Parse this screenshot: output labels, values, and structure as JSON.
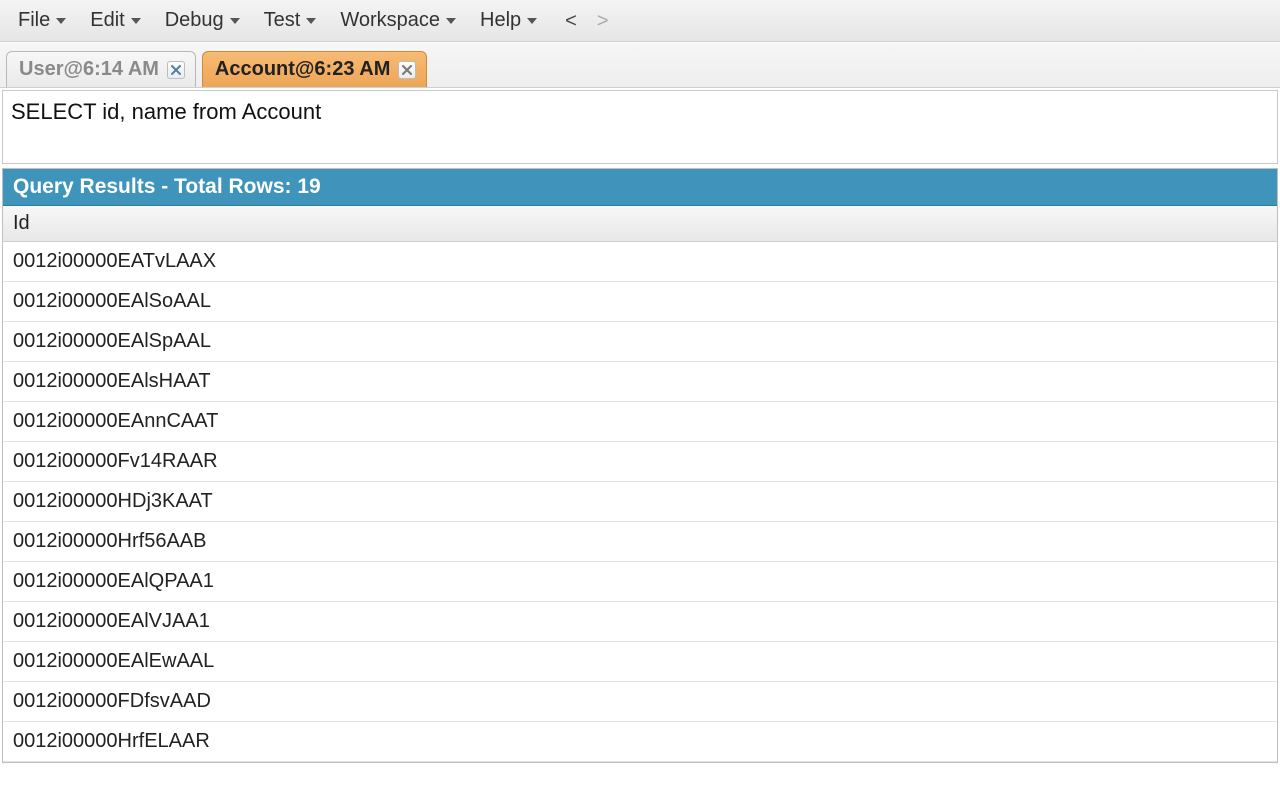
{
  "menubar": {
    "items": [
      {
        "label": "File"
      },
      {
        "label": "Edit"
      },
      {
        "label": "Debug"
      },
      {
        "label": "Test"
      },
      {
        "label": "Workspace"
      },
      {
        "label": "Help"
      }
    ],
    "nav_back": "<",
    "nav_forward": ">"
  },
  "tabs": [
    {
      "label": "User@6:14 AM",
      "active": false
    },
    {
      "label": "Account@6:23 AM",
      "active": true
    }
  ],
  "editor": {
    "content": "SELECT id, name from Account"
  },
  "results": {
    "header_prefix": "Query Results - Total Rows: ",
    "total_rows": "19",
    "columns": [
      {
        "label": "Id"
      }
    ],
    "rows": [
      "0012i00000EATvLAAX",
      "0012i00000EAlSoAAL",
      "0012i00000EAlSpAAL",
      "0012i00000EAlsHAAT",
      "0012i00000EAnnCAAT",
      "0012i00000Fv14RAAR",
      "0012i00000HDj3KAAT",
      "0012i00000Hrf56AAB",
      "0012i00000EAlQPAA1",
      "0012i00000EAlVJAA1",
      "0012i00000EAlEwAAL",
      "0012i00000FDfsvAAD",
      "0012i00000HrfELAAR"
    ]
  }
}
